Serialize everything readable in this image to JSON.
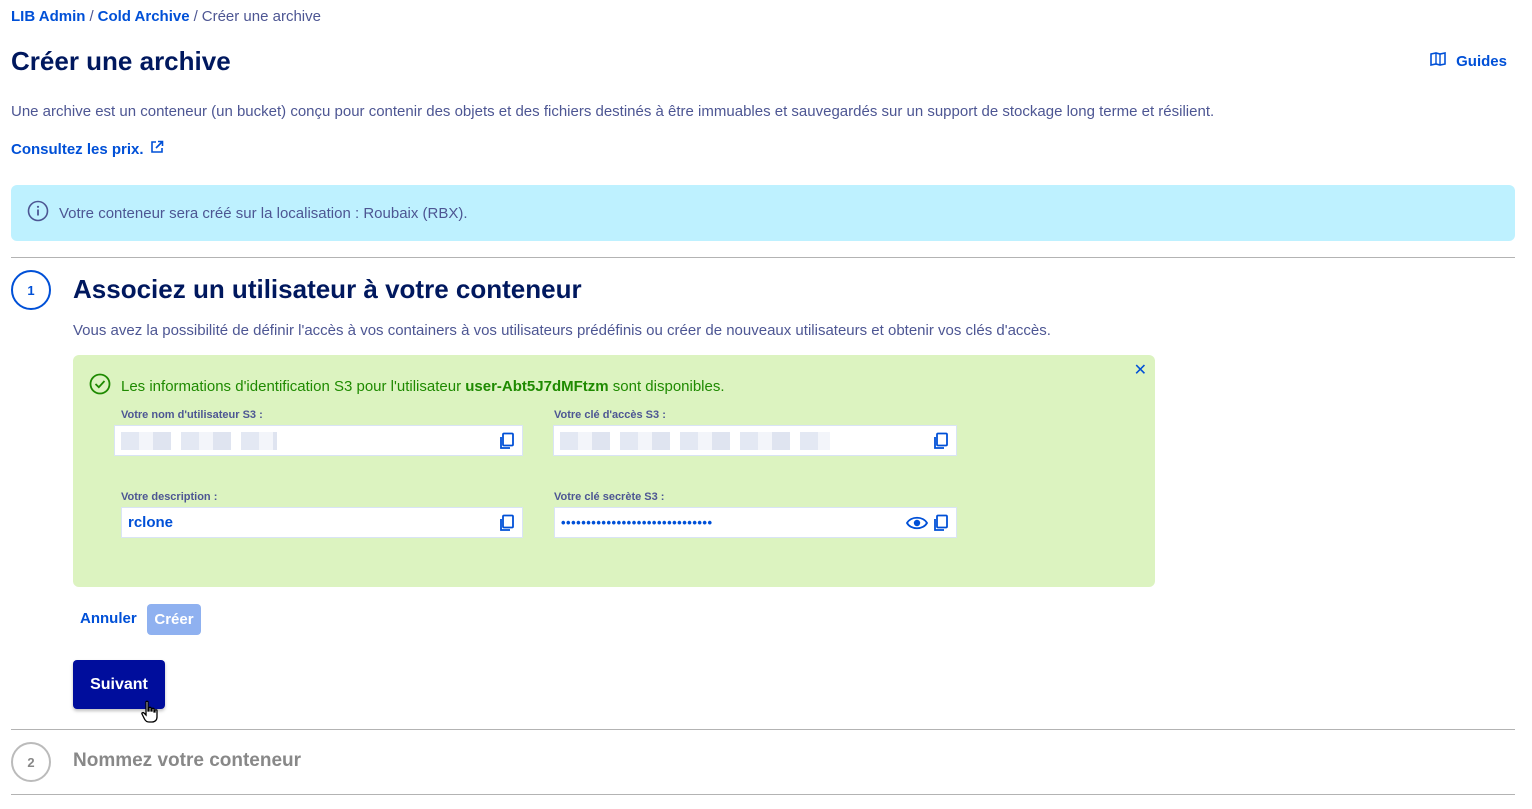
{
  "breadcrumb": {
    "item1": "LIB Admin",
    "item2": "Cold Archive",
    "current": "Créer une archive",
    "separator": "/"
  },
  "page": {
    "title": "Créer une archive",
    "guides_label": "Guides"
  },
  "intro": {
    "text": "Une archive est un conteneur (un bucket) conçu pour contenir des objets et des fichiers destinés à être immuables et sauvegardés sur un support de stockage long terme et résilient.",
    "prices_link": "Consultez les prix."
  },
  "info_banner": {
    "text": "Votre conteneur sera créé sur la localisation : Roubaix (RBX)."
  },
  "step1": {
    "number": "1",
    "title": "Associez un utilisateur à votre conteneur",
    "description": "Vous avez la possibilité de définir l'accès à vos containers à vos utilisateurs prédéfinis ou créer de nouveaux utilisateurs et obtenir vos clés d'accès.",
    "success": {
      "prefix": "Les informations d'identification S3 pour l'utilisateur",
      "user": "user-Abt5J7dMFtzm",
      "suffix": "sont disponibles."
    },
    "fields": {
      "username_label": "Votre nom d'utilisateur S3 :",
      "access_key_label": "Votre clé d'accès S3 :",
      "description_label": "Votre description :",
      "description_value": "rclone",
      "secret_key_label": "Votre clé secrète S3 :",
      "secret_key_value": "••••••••••••••••••••••••••••••"
    },
    "cancel_label": "Annuler",
    "create_label": "Créer",
    "next_label": "Suivant"
  },
  "step2": {
    "number": "2",
    "title": "Nommez votre conteneur"
  },
  "colors": {
    "primary": "#0050d7",
    "title": "#00185e",
    "info_bg": "#bef1ff",
    "success_bg": "#dcf3c0",
    "success_text": "#1e8a00",
    "next_bg": "#000d9c"
  },
  "icons": {
    "guides": "book-icon",
    "external": "external-link-icon",
    "info": "info-icon",
    "success": "check-circle-icon",
    "copy": "copy-icon",
    "reveal": "eye-icon",
    "close": "close-icon"
  }
}
